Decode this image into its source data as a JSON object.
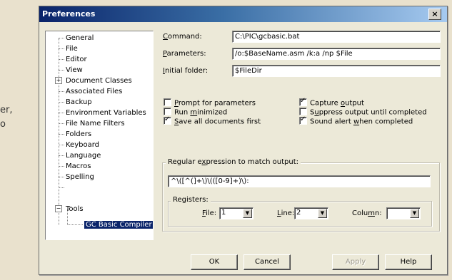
{
  "background": {
    "line1": "er,",
    "line2": "o"
  },
  "window": {
    "title": "Preferences",
    "close_glyph": "×"
  },
  "tree": {
    "items": [
      "General",
      "File",
      "Editor",
      "View",
      "Document Classes",
      "Associated Files",
      "Backup",
      "Environment Variables",
      "File Name Filters",
      "Folders",
      "Keyboard",
      "Language",
      "Macros",
      "Spelling",
      "Tools"
    ],
    "child": "GC Basic Compiler",
    "expand_glyph": "+",
    "collapse_glyph": "−"
  },
  "fields": {
    "command": {
      "label_u": "C",
      "label_rest": "ommand:",
      "value": "C:\\PIC\\gcbasic.bat"
    },
    "parameters": {
      "label_u": "P",
      "label_rest": "arameters:",
      "value": "/o:$BaseName.asm /k:a /np $File"
    },
    "initial_folder": {
      "label_u": "I",
      "label_rest": "nitial folder:",
      "value": "$FileDir"
    }
  },
  "options": {
    "prompt": {
      "u": "P",
      "rest": "rompt for parameters",
      "checked": false
    },
    "run_min": {
      "pre": "Run ",
      "u": "m",
      "rest": "inimized",
      "checked": false
    },
    "save_all": {
      "u": "S",
      "rest": "ave all documents first",
      "checked": true
    },
    "capture": {
      "pre": "Capture ",
      "u": "o",
      "rest": "utput",
      "checked": true
    },
    "suppress": {
      "pre": "S",
      "u": "u",
      "rest": "ppress output until completed",
      "checked": false
    },
    "sound": {
      "pre": "Sound alert ",
      "u": "w",
      "rest": "hen completed",
      "checked": true
    }
  },
  "regex": {
    "group_pre": "Regular e",
    "group_u": "x",
    "group_rest": "pression to match output:",
    "value": "^\\([^(]+\\)\\(([0-9]+)\\):",
    "registers_label": "Registers:",
    "file_u": "F",
    "file_rest": "ile:",
    "file_value": "1",
    "line_u": "L",
    "line_rest": "ine:",
    "line_value": "2",
    "column_pre": "Colu",
    "column_u": "m",
    "column_rest": "n:",
    "column_value": "",
    "arrow_glyph": "▼"
  },
  "buttons": {
    "ok": "OK",
    "cancel": "Cancel",
    "apply": "Apply",
    "help": "Help"
  }
}
